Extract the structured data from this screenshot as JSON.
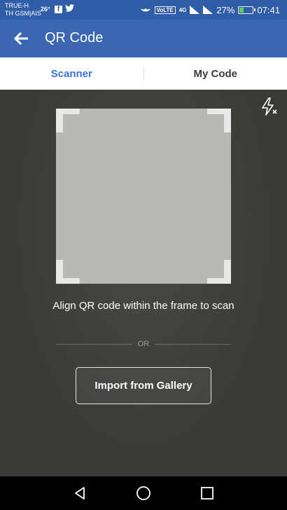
{
  "status_bar": {
    "carrier_line1": "TRUE-H",
    "carrier_line2": "TH GSM|AIS",
    "temperature": "26°",
    "battery_percent": "27%",
    "volte_label": "VoLTE",
    "network_label": "4G",
    "time": "07:41",
    "icons": [
      "facebook-icon",
      "twitter-icon",
      "hotspot-icon",
      "signal-icon",
      "battery-icon"
    ]
  },
  "app_bar": {
    "title": "QR Code",
    "back_icon": "arrow-left-icon"
  },
  "tabs": [
    {
      "label": "Scanner",
      "active": true
    },
    {
      "label": "My Code",
      "active": false
    }
  ],
  "scanner": {
    "hint": "Align QR code within the frame to scan",
    "or_label": "OR",
    "import_label": "Import from Gallery",
    "flash_icon": "flash-off-icon"
  },
  "colors": {
    "app_bar": "#3b66b1",
    "status_bar": "#2f5da8",
    "active_tab": "#3b74d6",
    "camera_bg": "#3a3936"
  }
}
